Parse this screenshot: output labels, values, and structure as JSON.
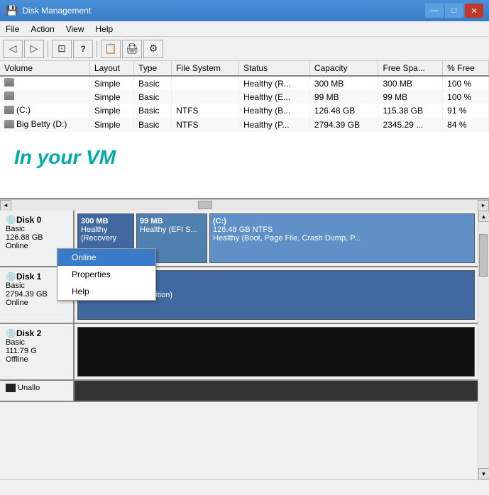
{
  "window": {
    "title": "Disk Management",
    "icon": "💾"
  },
  "titlebar": {
    "minimize": "—",
    "maximize": "□",
    "close": "✕"
  },
  "menu": {
    "items": [
      "File",
      "Action",
      "View",
      "Help"
    ]
  },
  "toolbar": {
    "buttons": [
      "◁",
      "▷",
      "⊡",
      "?",
      "⊟",
      "📄",
      "🖨",
      "⚙"
    ]
  },
  "table": {
    "columns": [
      "Volume",
      "Layout",
      "Type",
      "File System",
      "Status",
      "Capacity",
      "Free Spa...",
      "% Free"
    ],
    "rows": [
      {
        "volume": "",
        "layout": "Simple",
        "type": "Basic",
        "fs": "",
        "status": "Healthy (R...",
        "capacity": "300 MB",
        "free": "300 MB",
        "pct": "100 %"
      },
      {
        "volume": "",
        "layout": "Simple",
        "type": "Basic",
        "fs": "",
        "status": "Healthy (E...",
        "capacity": "99 MB",
        "free": "99 MB",
        "pct": "100 %"
      },
      {
        "volume": "(C:)",
        "layout": "Simple",
        "type": "Basic",
        "fs": "NTFS",
        "status": "Healthy (B...",
        "capacity": "126.48 GB",
        "free": "115.38 GB",
        "pct": "91 %"
      },
      {
        "volume": "Big Betty (D:)",
        "layout": "Simple",
        "type": "Basic",
        "fs": "NTFS",
        "status": "Healthy (P...",
        "capacity": "2794.39 GB",
        "free": "2345.29 ...",
        "pct": "84 %"
      }
    ]
  },
  "vm_text": "In your VM",
  "disks": [
    {
      "name": "Disk 0",
      "type": "Basic",
      "size": "126.88 GB",
      "status": "Online",
      "partitions": [
        {
          "label": "300 MB",
          "sublabel": "Healthy (Recovery",
          "type": "small"
        },
        {
          "label": "99 MB",
          "sublabel": "Healthy (EFI S...",
          "type": "medium"
        },
        {
          "label": "(C:)",
          "sublabel": "126.48 GB NTFS",
          "detail": "Healthy (Boot, Page File, Crash Dump, P...",
          "type": "large"
        }
      ]
    },
    {
      "name": "Disk 1",
      "type": "Basic",
      "size": "2794.39 GB",
      "status": "Online",
      "partitions": [
        {
          "label": "Big Betty (D:)",
          "sublabel": "2794.39 GB NTFS",
          "detail": "Healthy (Primary Partition)",
          "type": "huge"
        }
      ]
    },
    {
      "name": "Disk 2",
      "type": "Basic",
      "size": "111.79 G",
      "status": "Offline",
      "partitions": [
        {
          "label": "",
          "sublabel": "",
          "type": "offline"
        }
      ]
    }
  ],
  "context_menu": {
    "items": [
      "Online",
      "Properties",
      "Help"
    ],
    "highlighted": "Online"
  },
  "unalloc": {
    "label": "Unallo"
  },
  "status_bar": {
    "text": ""
  }
}
